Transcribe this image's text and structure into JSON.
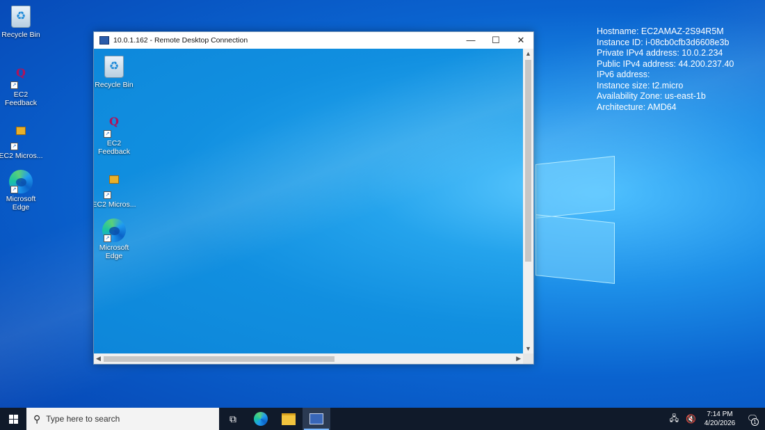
{
  "sysinfo": {
    "hostname": "Hostname: EC2AMAZ-2S94R5M",
    "instance_id": "Instance ID: i-08cb0cfb3d6608e3b",
    "private_ip": "Private IPv4 address: 10.0.2.234",
    "public_ip": "Public IPv4 address: 44.200.237.40",
    "ipv6": "IPv6 address:",
    "instance_size": "Instance size: t2.micro",
    "availability_zone": "Availability Zone: us-east-1b",
    "architecture": "Architecture: AMD64"
  },
  "desktop_icons": {
    "recycle_bin": "Recycle Bin",
    "ec2_feedback": "EC2 Feedback",
    "ec2_micros": "EC2 Micros...",
    "microsoft_edge": "Microsoft Edge"
  },
  "rdp_window": {
    "title": "10.0.1.162 - Remote Desktop Connection",
    "minimize_glyph": "—",
    "maximize_glyph": "☐",
    "close_glyph": "✕",
    "icons": {
      "recycle_bin": "Recycle Bin",
      "ec2_feedback": "EC2 Feedback",
      "ec2_micros": "EC2 Micros...",
      "microsoft_edge": "Microsoft Edge"
    }
  },
  "taskbar": {
    "search_placeholder": "Type here to search",
    "time": "7:14 PM",
    "date": "4/20/2026",
    "notification_count": "1"
  },
  "icons": {
    "search": "search-icon",
    "task_view": "task-view-icon",
    "edge": "edge-icon",
    "file_explorer": "folder-icon",
    "rdp": "remote-desktop-icon",
    "network": "network-icon",
    "volume": "volume-muted-icon",
    "notifications": "notification-icon"
  }
}
